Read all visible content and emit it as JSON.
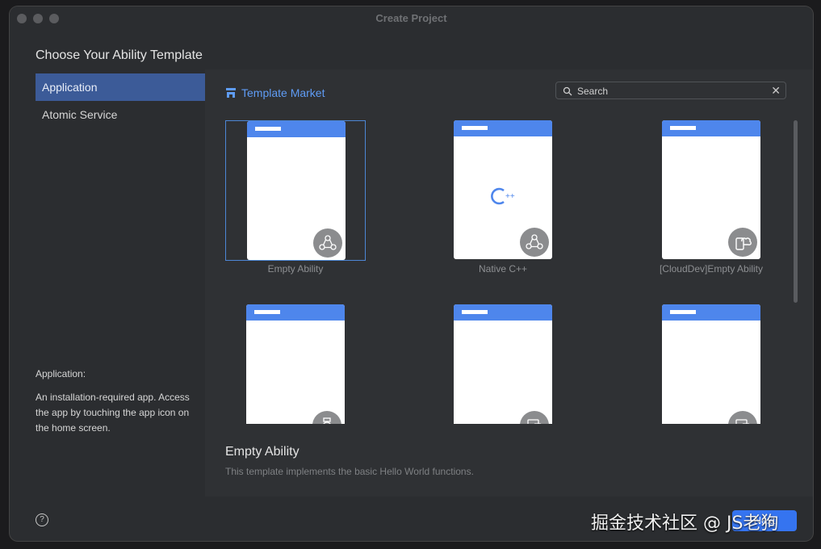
{
  "window": {
    "title": "Create Project"
  },
  "heading": "Choose Your Ability Template",
  "sidebar": {
    "items": [
      {
        "label": "Application",
        "selected": true
      },
      {
        "label": "Atomic Service",
        "selected": false
      }
    ],
    "description_title": "Application:",
    "description_body": "An installation-required app. Access the app by touching the app icon on the home screen."
  },
  "market": {
    "label": "Template Market",
    "icon": "store-icon"
  },
  "search": {
    "placeholder": "Search",
    "value": ""
  },
  "templates": [
    {
      "name": "Empty Ability",
      "badge": "triangle-nodes-icon",
      "selected": true
    },
    {
      "name": "Native C++",
      "badge": "triangle-nodes-icon",
      "logo": "C++"
    },
    {
      "name": "[CloudDev]Empty Ability",
      "badge": "cloud-device-icon"
    },
    {
      "name": "",
      "badge": "watch-icon"
    },
    {
      "name": "",
      "badge": "devices-icon"
    },
    {
      "name": "",
      "badge": "devices-icon"
    }
  ],
  "selected_template": {
    "title": "Empty Ability",
    "description": "This template implements the basic Hello World functions."
  },
  "footer": {
    "next_label": "Next"
  },
  "watermark": "掘金技术社区 @ JS老狗",
  "colors": {
    "accent": "#3574f0",
    "selection": "#3c5b98",
    "card_header": "#4e86ec",
    "link": "#5f9cf5"
  }
}
